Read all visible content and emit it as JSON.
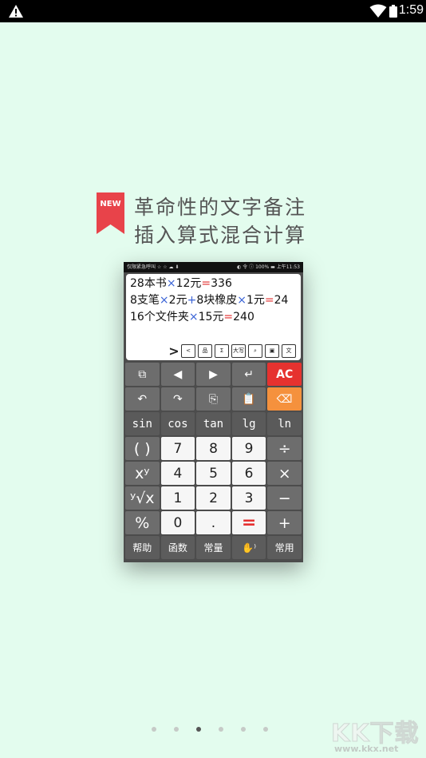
{
  "status_bar": {
    "time": "1:59",
    "icons": [
      "warning-icon",
      "wifi-icon",
      "battery-icon"
    ]
  },
  "headline": {
    "badge": "NEW",
    "line1": "革命性的文字备注",
    "line2": "插入算式混合计算",
    "badge_color": "#e8434a"
  },
  "mini_status": {
    "left": "仅限紧急呼叫 ☆ ☆ ☁ ⬇",
    "right": "◐ 令 ⓘ 100% ▬ 上午11:53"
  },
  "display": {
    "lines": [
      [
        {
          "t": "28本书",
          "c": "n"
        },
        {
          "t": "×",
          "c": "x"
        },
        {
          "t": "12元",
          "c": "n"
        },
        {
          "t": "=",
          "c": "e"
        },
        {
          "t": "336",
          "c": "n"
        }
      ],
      [
        {
          "t": "8支笔",
          "c": "n"
        },
        {
          "t": "×",
          "c": "x"
        },
        {
          "t": "2元",
          "c": "n"
        },
        {
          "t": "+",
          "c": "x"
        },
        {
          "t": "8块橡皮",
          "c": "n"
        },
        {
          "t": "×",
          "c": "x"
        },
        {
          "t": "1元",
          "c": "n"
        },
        {
          "t": "=",
          "c": "e"
        },
        {
          "t": "24",
          "c": "n"
        }
      ],
      [
        {
          "t": "16个文件夹",
          "c": "n"
        },
        {
          "t": "×",
          "c": "x"
        },
        {
          "t": "15元",
          "c": "n"
        },
        {
          "t": "=",
          "c": "e"
        },
        {
          "t": "240",
          "c": "n"
        }
      ]
    ],
    "tools": [
      {
        "name": "expand-arrow-icon",
        "label": ">"
      },
      {
        "name": "share-icon",
        "label": "<"
      },
      {
        "name": "print-icon",
        "label": "品"
      },
      {
        "name": "sum-icon",
        "label": "Σ"
      },
      {
        "name": "uppercase-icon",
        "label": "大写"
      },
      {
        "name": "search-icon",
        "label": "⌕"
      },
      {
        "name": "save-icon",
        "label": "▣"
      },
      {
        "name": "text-icon",
        "label": "文"
      }
    ]
  },
  "keypad": [
    [
      {
        "name": "copy-window-key",
        "label": "⧉",
        "k": "k-gray"
      },
      {
        "name": "left-arrow-key",
        "label": "◀",
        "k": "k-gray"
      },
      {
        "name": "right-arrow-key",
        "label": "▶",
        "k": "k-gray"
      },
      {
        "name": "enter-key",
        "label": "↵",
        "k": "k-gray"
      },
      {
        "name": "clear-all-key",
        "label": "AC",
        "k": "k-red"
      }
    ],
    [
      {
        "name": "undo-key",
        "label": "↶",
        "k": "k-gray"
      },
      {
        "name": "redo-key",
        "label": "↷",
        "k": "k-gray"
      },
      {
        "name": "copy-key",
        "label": "⎘",
        "k": "k-gray"
      },
      {
        "name": "paste-key",
        "label": "📋",
        "k": "k-gray"
      },
      {
        "name": "backspace-key",
        "label": "⌫",
        "k": "k-orange"
      }
    ],
    [
      {
        "name": "sin-key",
        "label": "sin",
        "k": "k-func"
      },
      {
        "name": "cos-key",
        "label": "cos",
        "k": "k-func"
      },
      {
        "name": "tan-key",
        "label": "tan",
        "k": "k-func"
      },
      {
        "name": "lg-key",
        "label": "lg",
        "k": "k-func"
      },
      {
        "name": "ln-key",
        "label": "ln",
        "k": "k-func"
      }
    ],
    [
      {
        "name": "parentheses-key",
        "label": "( )",
        "k": "k-op"
      },
      {
        "name": "digit-7-key",
        "label": "7",
        "k": "k-num"
      },
      {
        "name": "digit-8-key",
        "label": "8",
        "k": "k-num"
      },
      {
        "name": "digit-9-key",
        "label": "9",
        "k": "k-num"
      },
      {
        "name": "divide-key",
        "label": "÷",
        "k": "k-op"
      }
    ],
    [
      {
        "name": "power-key",
        "label": "xʸ",
        "k": "k-op"
      },
      {
        "name": "digit-4-key",
        "label": "4",
        "k": "k-num"
      },
      {
        "name": "digit-5-key",
        "label": "5",
        "k": "k-num"
      },
      {
        "name": "digit-6-key",
        "label": "6",
        "k": "k-num"
      },
      {
        "name": "multiply-key",
        "label": "×",
        "k": "k-op"
      }
    ],
    [
      {
        "name": "root-key",
        "label": "ʸ√x",
        "k": "k-op"
      },
      {
        "name": "digit-1-key",
        "label": "1",
        "k": "k-num"
      },
      {
        "name": "digit-2-key",
        "label": "2",
        "k": "k-num"
      },
      {
        "name": "digit-3-key",
        "label": "3",
        "k": "k-num"
      },
      {
        "name": "minus-key",
        "label": "−",
        "k": "k-op"
      }
    ],
    [
      {
        "name": "percent-key",
        "label": "%",
        "k": "k-op"
      },
      {
        "name": "digit-0-key",
        "label": "0",
        "k": "k-num"
      },
      {
        "name": "decimal-key",
        "label": ".",
        "k": "k-num"
      },
      {
        "name": "equals-key",
        "label": "=",
        "k": "k-equals"
      },
      {
        "name": "plus-key",
        "label": "+",
        "k": "k-op"
      }
    ],
    [
      {
        "name": "help-key",
        "label": "帮助",
        "k": "k-bottom"
      },
      {
        "name": "functions-key",
        "label": "函数",
        "k": "k-bottom"
      },
      {
        "name": "constants-key",
        "label": "常量",
        "k": "k-bottom"
      },
      {
        "name": "voice-key",
        "label": "✋⁾",
        "k": "k-bottom"
      },
      {
        "name": "common-key",
        "label": "常用",
        "k": "k-bottom"
      }
    ]
  ],
  "pager": {
    "count": 6,
    "active": 3
  },
  "watermark": {
    "logo": "KK下载",
    "url": "www.kkx.net"
  }
}
